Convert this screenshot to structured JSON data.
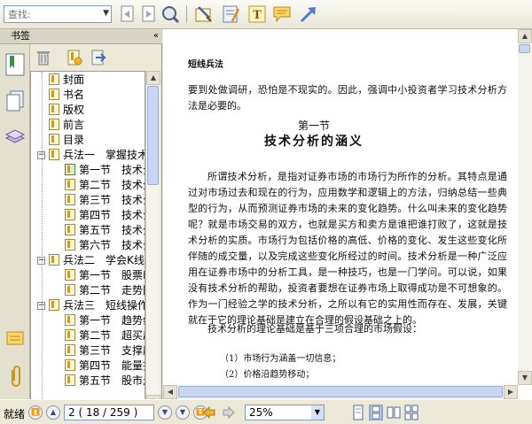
{
  "toolbar": {
    "search_placeholder": "查找:",
    "buttons": [
      {
        "name": "find-previous-icon"
      },
      {
        "name": "find-next-icon"
      },
      {
        "name": "find-options-icon"
      },
      {
        "name": "select-tool-icon"
      },
      {
        "name": "note-tool-icon"
      },
      {
        "name": "text-tool-icon"
      },
      {
        "name": "comment-tool-icon"
      },
      {
        "name": "arrow-tool-icon"
      }
    ]
  },
  "sidebar": {
    "title": "书签",
    "collapse_glyph": "«",
    "tabs": [
      "bookmarks-tab-icon",
      "pages-tab-icon",
      "layers-tab-icon",
      "comments-tab-icon",
      "attachments-tab-icon"
    ],
    "bookmarks": [
      {
        "label": "封面",
        "level": 1
      },
      {
        "label": "书名",
        "level": 1
      },
      {
        "label": "版权",
        "level": 1
      },
      {
        "label": "前言",
        "level": 1
      },
      {
        "label": "目录",
        "level": 1
      },
      {
        "label": "兵法一　掌握技术",
        "level": 1,
        "expanded": true
      },
      {
        "label": "第一节　技术分",
        "level": 2,
        "selected": true
      },
      {
        "label": "第二节　技术分",
        "level": 2
      },
      {
        "label": "第三节　技术分",
        "level": 2
      },
      {
        "label": "第四节　技术分",
        "level": 2
      },
      {
        "label": "第五节　技术分",
        "level": 2
      },
      {
        "label": "第六节　技术分",
        "level": 2
      },
      {
        "label": "兵法二　学会K线",
        "level": 1,
        "expanded": true
      },
      {
        "label": "第一节　股票K",
        "level": 2
      },
      {
        "label": "第二节　走势图",
        "level": 2
      },
      {
        "label": "兵法三　短线操作",
        "level": 1,
        "expanded": true
      },
      {
        "label": "第一节　趋势线",
        "level": 2
      },
      {
        "label": "第二节　超买超",
        "level": 2
      },
      {
        "label": "第三节　支撑压",
        "level": 2
      },
      {
        "label": "第四节　能量指",
        "level": 2
      },
      {
        "label": "第五节　股市走",
        "level": 2
      }
    ]
  },
  "document": {
    "running_header": "短线兵法",
    "para_top": "要到处做调研，恐怕是不现实的。因此，强调中小投资者学习技术分析方法是必要的。",
    "section_number": "第一节",
    "section_title": "技术分析的涵义",
    "para_main": "所谓技术分析，是指对证券市场的市场行为所作的分析。其特点是通过对市场过去和现在的行为，应用数学和逻辑上的方法，归纳总结一些典型的行为，从而预测证券市场的未来的变化趋势。什么叫未来的变化趋势呢？就是市场交易的双方，也就是买方和卖方是谁把谁打败了，这就是技术分析的实质。市场行为包括价格的高低、价格的变化、发生这些变化所伴随的成交量，以及完成这些变化所经过的时间。技术分析是一种广泛应用在证券市场中的分析工具，是一种技巧，也是一门学问。可以说，如果没有技术分析的帮助，投资者要想在证券市场上取得成功是不可想象的。作为一门经验之学的技术分析，之所以有它的实用性而存在、发展，关键就在于它的理论基础是建立在合理的假设基础之上的。",
    "para_hyp": "技术分析的理论基础是基于三项合理的市场假设：",
    "list": [
      "（1）市场行为涵盖一切信息；",
      "（2）价格沿趋势移动；"
    ]
  },
  "statusbar": {
    "status": "就绪",
    "page_display": "2 ( 18 / 259 )",
    "zoom": "25%"
  }
}
